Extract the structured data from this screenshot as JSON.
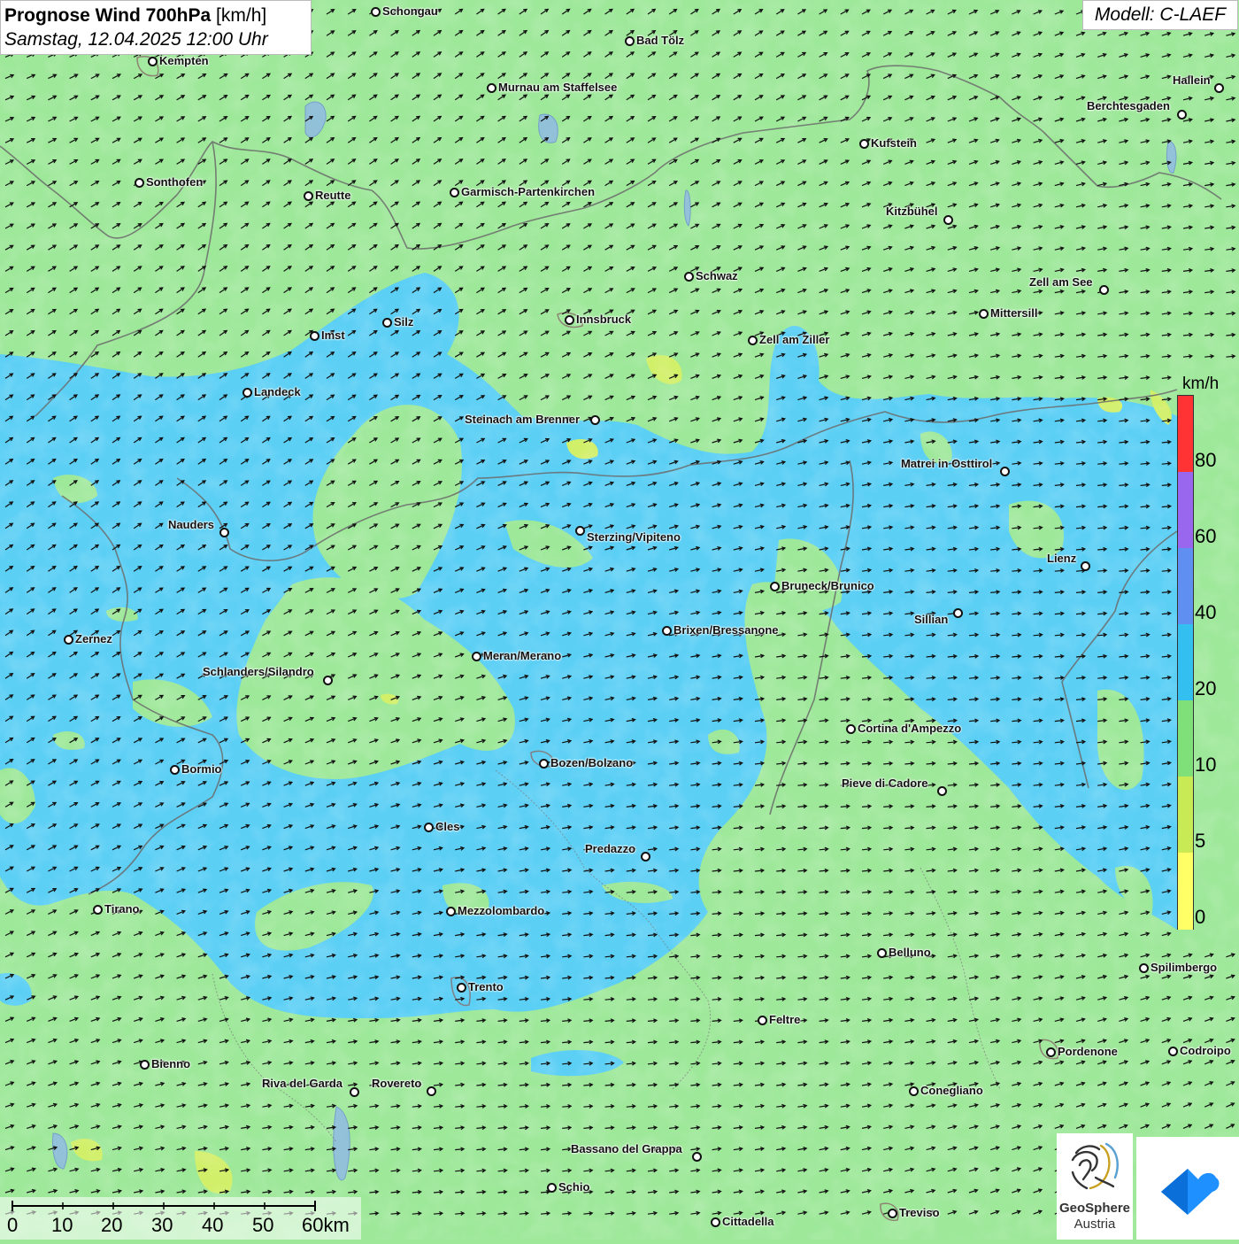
{
  "title": {
    "bold": "Prognose Wind 700hPa",
    "unit": "[km/h]",
    "date": "Samstag, 12.04.2025 12:00 Uhr"
  },
  "model": "Modell: C-LAEF",
  "colors": {
    "low_wind_green": "#9ee89a",
    "mid_wind_blue": "#5ccff5",
    "light_yellow_green": "#d2ef6a",
    "border_gray": "#666666",
    "arrow": "#111111"
  },
  "legend": {
    "unit": "km/h",
    "labels": [
      "80",
      "60",
      "40",
      "20",
      "10",
      "5",
      "0"
    ],
    "colors": [
      "#ff3333",
      "#9966ee",
      "#5f8ff0",
      "#33c0f0",
      "#7fe07a",
      "#c8ea55",
      "#ffff66"
    ]
  },
  "scale": {
    "labels": [
      "0",
      "10",
      "20",
      "30",
      "40",
      "50",
      "60km"
    ]
  },
  "logos": {
    "geosphere_line1": "GeoSphere",
    "geosphere_line2": "Austria",
    "geosphere_icon": "geosphere-fingerprint-icon",
    "app_icon": "warn-app-icon"
  },
  "cities": [
    {
      "name": "Schongau",
      "dot": [
        424,
        13
      ],
      "label": [
        432,
        13
      ]
    },
    {
      "name": "Bad Tölz",
      "dot": [
        711,
        46
      ],
      "label": [
        719,
        46
      ]
    },
    {
      "name": "Kempten",
      "dot": [
        172,
        69
      ],
      "label": [
        180,
        69
      ]
    },
    {
      "name": "Murnau am Staffelsee",
      "dot": [
        555,
        99
      ],
      "label": [
        563,
        99
      ]
    },
    {
      "name": "Hallein",
      "dot": [
        1377,
        99
      ],
      "label": [
        1325,
        91
      ]
    },
    {
      "name": "Berchtesgaden",
      "dot": [
        1335,
        129
      ],
      "label": [
        1228,
        120
      ]
    },
    {
      "name": "Kufstein",
      "dot": [
        976,
        162
      ],
      "label": [
        984,
        162
      ]
    },
    {
      "name": "Sonthofen",
      "dot": [
        157,
        206
      ],
      "label": [
        165,
        206
      ]
    },
    {
      "name": "Reutte",
      "dot": [
        348,
        221
      ],
      "label": [
        356,
        221
      ]
    },
    {
      "name": "Garmisch-Partenkirchen",
      "dot": [
        513,
        217
      ],
      "label": [
        521,
        217
      ]
    },
    {
      "name": "Kitzbühel",
      "dot": [
        1071,
        248
      ],
      "label": [
        1001,
        239
      ]
    },
    {
      "name": "Schwaz",
      "dot": [
        778,
        312
      ],
      "label": [
        786,
        312
      ]
    },
    {
      "name": "Zell am See",
      "dot": [
        1247,
        327
      ],
      "label": [
        1163,
        319
      ]
    },
    {
      "name": "Mittersill",
      "dot": [
        1111,
        354
      ],
      "label": [
        1119,
        354
      ]
    },
    {
      "name": "Innsbruck",
      "dot": [
        643,
        361
      ],
      "label": [
        651,
        361
      ]
    },
    {
      "name": "Silz",
      "dot": [
        437,
        364
      ],
      "label": [
        445,
        364
      ]
    },
    {
      "name": "Imst",
      "dot": [
        355,
        379
      ],
      "label": [
        363,
        379
      ]
    },
    {
      "name": "Zell am Ziller",
      "dot": [
        850,
        384
      ],
      "label": [
        858,
        384
      ]
    },
    {
      "name": "Landeck",
      "dot": [
        279,
        443
      ],
      "label": [
        287,
        443
      ]
    },
    {
      "name": "Steinach am Brenner",
      "dot": [
        672,
        474
      ],
      "label": [
        525,
        474
      ]
    },
    {
      "name": "Matrei in Osttirol",
      "dot": [
        1135,
        532
      ],
      "label": [
        1018,
        524
      ]
    },
    {
      "name": "Nauders",
      "dot": [
        253,
        601
      ],
      "label": [
        190,
        593
      ]
    },
    {
      "name": "Sterzing/Vipiteno",
      "dot": [
        655,
        599
      ],
      "label": [
        663,
        607
      ]
    },
    {
      "name": "Lienz",
      "dot": [
        1226,
        639
      ],
      "label": [
        1183,
        631
      ]
    },
    {
      "name": "Bruneck/Brunico",
      "dot": [
        875,
        662
      ],
      "label": [
        883,
        662
      ]
    },
    {
      "name": "Sillian",
      "dot": [
        1082,
        692
      ],
      "label": [
        1033,
        700
      ]
    },
    {
      "name": "Brixen/Bressanone",
      "dot": [
        753,
        712
      ],
      "label": [
        761,
        712
      ]
    },
    {
      "name": "Zernez",
      "dot": [
        77,
        722
      ],
      "label": [
        85,
        722
      ]
    },
    {
      "name": "Meran/Merano",
      "dot": [
        538,
        741
      ],
      "label": [
        546,
        741
      ]
    },
    {
      "name": "Schlanders/Silandro",
      "dot": [
        370,
        768
      ],
      "label": [
        229,
        759
      ]
    },
    {
      "name": "Cortina d'Ampezzo",
      "dot": [
        961,
        823
      ],
      "label": [
        969,
        823
      ]
    },
    {
      "name": "Bozen/Bolzano",
      "dot": [
        614,
        862
      ],
      "label": [
        622,
        862
      ]
    },
    {
      "name": "Bormio",
      "dot": [
        197,
        869
      ],
      "label": [
        205,
        869
      ]
    },
    {
      "name": "Pieve di Cadore",
      "dot": [
        1064,
        893
      ],
      "label": [
        951,
        885
      ]
    },
    {
      "name": "Cles",
      "dot": [
        484,
        934
      ],
      "label": [
        492,
        934
      ]
    },
    {
      "name": "Predazzo",
      "dot": [
        729,
        967
      ],
      "label": [
        661,
        959
      ]
    },
    {
      "name": "Tirano",
      "dot": [
        110,
        1027
      ],
      "label": [
        118,
        1027
      ]
    },
    {
      "name": "Mezzolombardo",
      "dot": [
        509,
        1029
      ],
      "label": [
        517,
        1029
      ]
    },
    {
      "name": "Belluno",
      "dot": [
        996,
        1076
      ],
      "label": [
        1004,
        1076
      ]
    },
    {
      "name": "Spilimbergo",
      "dot": [
        1292,
        1093
      ],
      "label": [
        1300,
        1093
      ]
    },
    {
      "name": "Trento",
      "dot": [
        521,
        1115
      ],
      "label": [
        529,
        1115
      ]
    },
    {
      "name": "Feltre",
      "dot": [
        861,
        1152
      ],
      "label": [
        869,
        1152
      ]
    },
    {
      "name": "Pordenone",
      "dot": [
        1187,
        1188
      ],
      "label": [
        1195,
        1188
      ]
    },
    {
      "name": "Codroipo",
      "dot": [
        1325,
        1187
      ],
      "label": [
        1333,
        1187
      ]
    },
    {
      "name": "Bienno",
      "dot": [
        163,
        1202
      ],
      "label": [
        171,
        1202
      ]
    },
    {
      "name": "Riva del Garda",
      "dot": [
        400,
        1233
      ],
      "label": [
        296,
        1224
      ]
    },
    {
      "name": "Rovereto",
      "dot": [
        487,
        1232
      ],
      "label": [
        420,
        1224
      ]
    },
    {
      "name": "Conegliano",
      "dot": [
        1032,
        1232
      ],
      "label": [
        1040,
        1232
      ]
    },
    {
      "name": "Bassano del Grappa",
      "dot": [
        787,
        1306
      ],
      "label": [
        645,
        1298
      ]
    },
    {
      "name": "Schio",
      "dot": [
        623,
        1341
      ],
      "label": [
        631,
        1341
      ]
    },
    {
      "name": "Treviso",
      "dot": [
        1008,
        1370
      ],
      "label": [
        1016,
        1370
      ]
    },
    {
      "name": "Cittadella",
      "dot": [
        808,
        1380
      ],
      "label": [
        816,
        1380
      ]
    }
  ]
}
